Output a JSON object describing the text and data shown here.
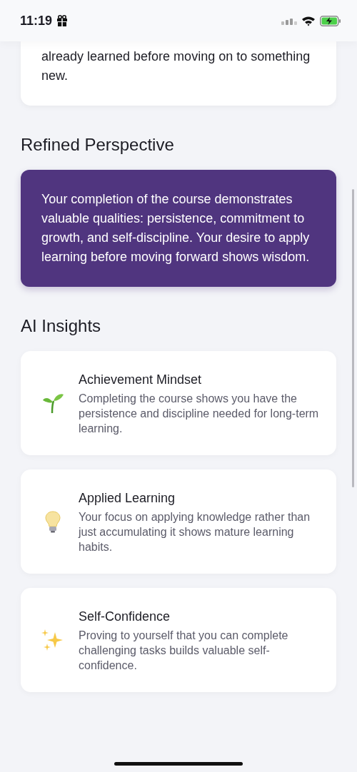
{
  "status_bar": {
    "time": "11:19"
  },
  "reflection_card": {
    "text": "already learned before moving on to something new."
  },
  "refined_perspective": {
    "heading": "Refined Perspective",
    "text": "Your completion of the course demonstrates valuable qualities: persistence, commitment to growth, and self-discipline. Your desire to apply learning before moving forward shows wisdom."
  },
  "ai_insights": {
    "heading": "AI Insights",
    "items": [
      {
        "kind": "sprout",
        "title": "Achievement Mindset",
        "text": "Completing the course shows you have the persistence and discipline needed for long-term learning."
      },
      {
        "kind": "bulb",
        "title": "Applied Learning",
        "text": "Your focus on applying knowledge rather than just accumulating it shows mature learning habits."
      },
      {
        "kind": "sparkles",
        "title": "Self-Confidence",
        "text": "Proving to yourself that you can complete challenging tasks builds valuable self-confidence."
      }
    ]
  }
}
